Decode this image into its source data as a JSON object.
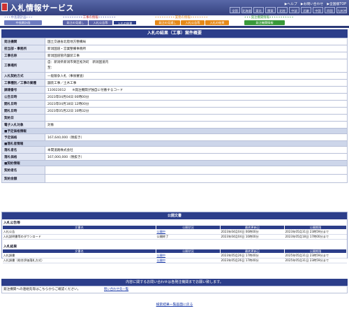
{
  "header": {
    "title": "入札情報サービス",
    "links": [
      "▶ヘルプ",
      "▶お問い合わせ",
      "▶全国版TOP"
    ],
    "regions": [
      "全国",
      "北海道",
      "東北",
      "関東",
      "北陸",
      "中部",
      "近畿",
      "中国",
      "四国",
      "九州沖縄"
    ]
  },
  "menu": {
    "groups": [
      {
        "caption": "中長期計画",
        "buttons": [
          "中長期計画"
        ],
        "color": "#6e7cc0",
        "cap_color": "#6e7cc0"
      },
      {
        "caption": "工事の情報",
        "buttons": [
          "発注の見通し",
          "入札公告等",
          "入札の結果"
        ],
        "color": "#5a62a8",
        "cap_color": "#c03030"
      },
      {
        "caption": "業務の情報",
        "buttons": [
          "発注の見通し",
          "入札公告等",
          "入札の結果"
        ],
        "color": "#e58a1a",
        "cap_color": "#e58a1a"
      },
      {
        "caption": "発注機関情報",
        "buttons": [
          "発注機関情報"
        ],
        "color": "#3a9a3a",
        "cap_color": "#3a9a3a"
      }
    ]
  },
  "detail": {
    "title": "入札の結果（工事）案件概要",
    "rows": [
      {
        "label": "発注機関",
        "value": "国土交通省北陸地方整備局"
      },
      {
        "label": "担当部・事務所",
        "value": "新潟国道・営業整備事務所"
      },
      {
        "label": "工事名称",
        "value": "新潟国道管内舗装工事"
      },
      {
        "label": "工事場所",
        "lines": [
          "自：新潟県新潟市東区松浜町　新潟国道内",
          "至："
        ]
      },
      {
        "label": "入札契約方式",
        "value": "一般競争入札（事後審査）"
      },
      {
        "label": "工事種別／工事の業種",
        "value": "舗装工事／土木工事"
      },
      {
        "label": "調達番号",
        "value": "110023012　　※発注機関が独自に付番するコード"
      },
      {
        "label": "公告日時",
        "value": "2023年04月04日 00時00分"
      },
      {
        "label": "開札日時",
        "value": "2023年04月18日 12時00分"
      },
      {
        "label": "開札日時",
        "value": "2023年05月22日 10時32分"
      },
      {
        "label": "契約日",
        "value": ""
      },
      {
        "label": "電子入札対象",
        "value": "対象"
      }
    ],
    "price_title": "■予定価格情報",
    "price_rows": [
      {
        "label": "予定価格",
        "value": "167,640,000（税抜き）"
      }
    ],
    "winner_title": "■落札者情報",
    "winner_rows": [
      {
        "label": "落札者名",
        "value": "本間道路株式会社"
      },
      {
        "label": "落札価格",
        "value": "167,000,000（税抜き）"
      }
    ],
    "contract_title": "■契約情報",
    "contract_rows": [
      {
        "label": "契約者名",
        "value": ""
      },
      {
        "label": "契約金額",
        "value": ""
      }
    ]
  },
  "documents": {
    "title": "公開文書",
    "columns": [
      "文書名",
      "公開状況",
      "最終更新日",
      "公開期限"
    ],
    "groups": [
      {
        "title": "入札公告等",
        "rows": [
          {
            "name": "入札公告",
            "status": "公開中",
            "updated": "2023年04月04日 00時00分",
            "period": "2023年05月31日 23時59分まで"
          },
          {
            "name": "入札説明書等のダウンロード",
            "status": "公開終了",
            "updated": "2023年04月04日 10時00分",
            "period": "2023年05月18日 17時00分まで"
          }
        ]
      },
      {
        "title": "入札結果",
        "rows": [
          {
            "name": "入札調書",
            "status": "公開中",
            "updated": "2023年05月26日 17時40分",
            "period": "2025年05月31日 23時59分まで"
          },
          {
            "name": "入札調書（総合評価落札方式）",
            "status": "公開中",
            "updated": "2023年05月26日 17時40分",
            "period": "2025年05月31日 23時59分まで"
          }
        ]
      }
    ]
  },
  "contact": {
    "bar": "内容に関するお問い合わせは各発注機関までお願い致します。",
    "text": "発注機関への連絡先等はこちらからご確認ください。",
    "link": "問い合わせ先一覧"
  },
  "back_link": "検索結果一覧画面に戻る"
}
